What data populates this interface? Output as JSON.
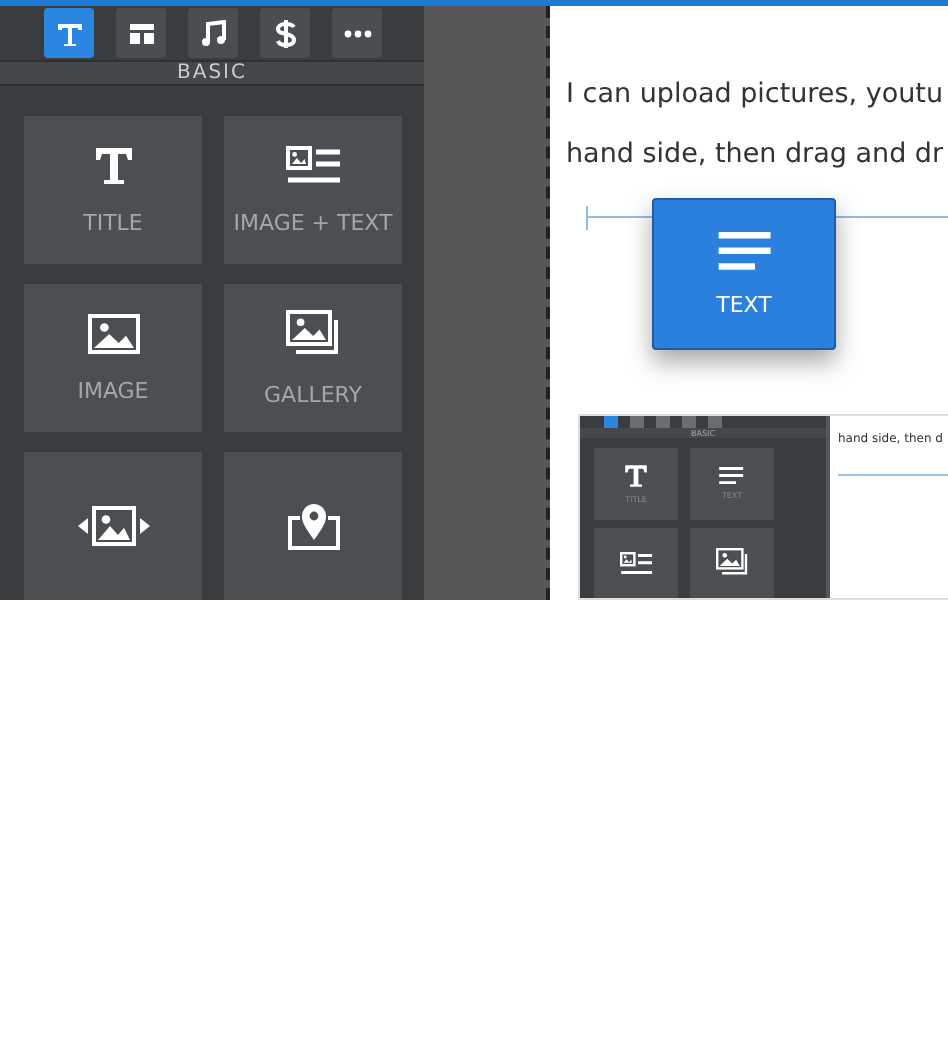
{
  "toolbar": [
    {
      "kind": "text",
      "selected": true
    },
    {
      "kind": "layout",
      "selected": false
    },
    {
      "kind": "music",
      "selected": false
    },
    {
      "kind": "dollar",
      "selected": false
    },
    {
      "kind": "more",
      "selected": false
    }
  ],
  "section_title": "BASIC",
  "tiles": [
    {
      "kind": "title",
      "label": "TITLE"
    },
    {
      "kind": "image-text",
      "label": "IMAGE + TEXT"
    },
    {
      "kind": "image",
      "label": "IMAGE"
    },
    {
      "kind": "gallery",
      "label": "GALLERY"
    },
    {
      "kind": "slider"
    },
    {
      "kind": "map"
    }
  ],
  "canvas": {
    "lines": [
      "I can upload pictures, youtu",
      "hand side, then drag and dr"
    ]
  },
  "dragged_tile": {
    "label": "TEXT"
  },
  "inner_screenshot": {
    "section_title": "BASIC",
    "tiles": [
      {
        "kind": "title",
        "label": "TITLE"
      },
      {
        "kind": "text",
        "label": "TEXT"
      },
      {
        "kind": "image-text"
      },
      {
        "kind": "gallery"
      }
    ],
    "text": "hand side, then d"
  }
}
